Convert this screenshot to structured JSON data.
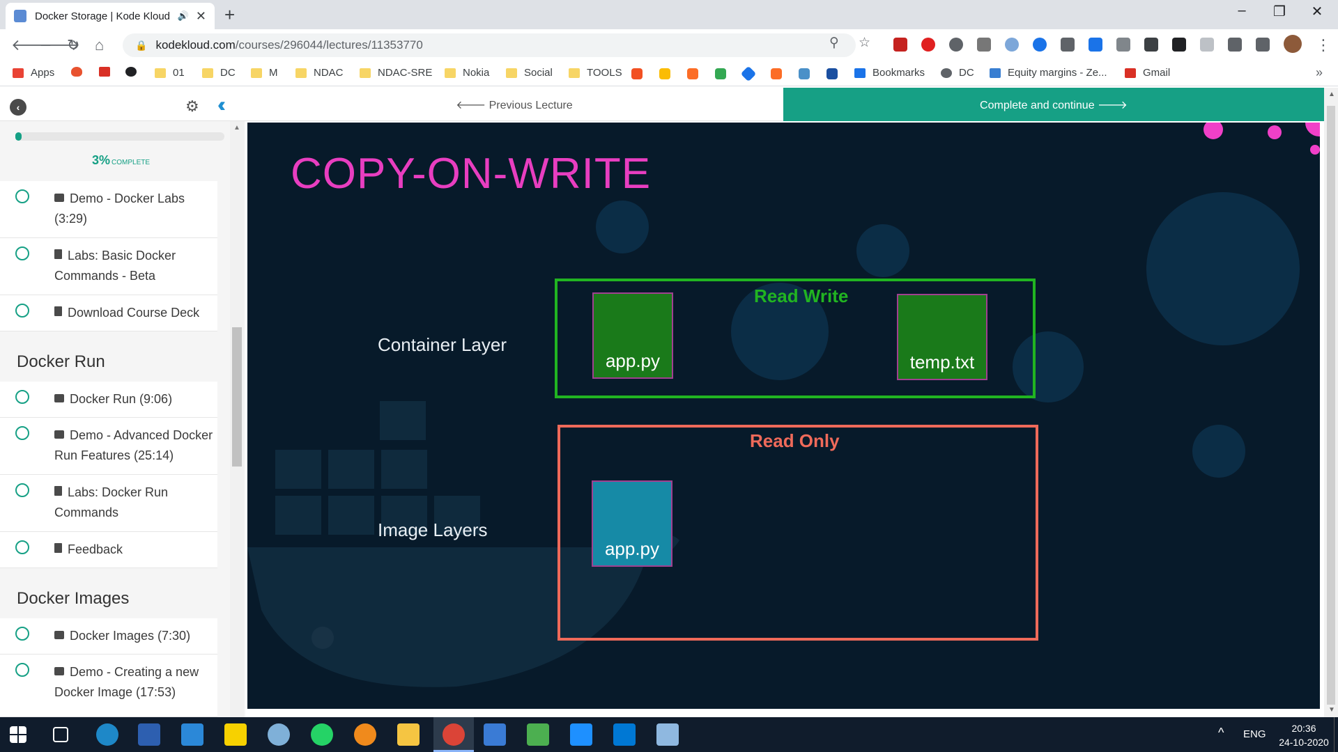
{
  "browser": {
    "tab_title": "Docker Storage | Kode Kloud",
    "new_tab_symbol": "+",
    "url_domain": "kodekloud.com",
    "url_path": "/courses/296044/lectures/11353770",
    "window_controls": [
      "–",
      "❐",
      "✕"
    ]
  },
  "bookmarks": [
    {
      "label": "Apps",
      "icon": "apps-grid-icon",
      "color": "#e94335"
    },
    {
      "label": "",
      "icon": "flame-icon",
      "color": "#e8522f"
    },
    {
      "label": "",
      "icon": "gmail-icon",
      "color": "#d93025"
    },
    {
      "label": "",
      "icon": "github-icon",
      "color": "#202124"
    },
    {
      "label": "01",
      "icon": "folder-icon",
      "color": "#f7d565"
    },
    {
      "label": "DC",
      "icon": "folder-icon",
      "color": "#f7d565"
    },
    {
      "label": "M",
      "icon": "folder-icon",
      "color": "#f7d565"
    },
    {
      "label": "NDAC",
      "icon": "folder-icon",
      "color": "#f7d565"
    },
    {
      "label": "NDAC-SRE",
      "icon": "folder-icon",
      "color": "#f7d565"
    },
    {
      "label": "Nokia",
      "icon": "folder-icon",
      "color": "#f7d565"
    },
    {
      "label": "Social",
      "icon": "folder-icon",
      "color": "#f7d565"
    },
    {
      "label": "TOOLS",
      "icon": "folder-icon",
      "color": "#f7d565"
    },
    {
      "label": "Bookmarks",
      "icon": "star-icon",
      "color": "#1a73e8"
    },
    {
      "label": "DC",
      "icon": "gear-globe-icon",
      "color": "#5f6368"
    },
    {
      "label": "Equity margins - Ze...",
      "icon": "zerodha-icon",
      "color": "#387ed1"
    },
    {
      "label": "Gmail",
      "icon": "gmail-icon",
      "color": "#d93025"
    }
  ],
  "sidebar": {
    "progress_percent": "3%",
    "progress_suffix": "COMPLETE",
    "progress_value": 0.03,
    "items_top": [
      {
        "label": "Demo - Docker Labs (3:29)",
        "kind": "video"
      },
      {
        "label": "Labs: Basic Docker Commands - Beta",
        "kind": "doc"
      },
      {
        "label": "Download Course Deck",
        "kind": "doc"
      }
    ],
    "section_docker_run": "Docker Run",
    "items_run": [
      {
        "label": "Docker Run (9:06)",
        "kind": "video"
      },
      {
        "label": "Demo - Advanced Docker Run Features (25:14)",
        "kind": "video"
      },
      {
        "label": "Labs: Docker Run Commands",
        "kind": "doc"
      },
      {
        "label": "Feedback",
        "kind": "doc"
      }
    ],
    "section_docker_images": "Docker Images",
    "items_images": [
      {
        "label": "Docker Images (7:30)",
        "kind": "video"
      },
      {
        "label": "Demo - Creating a new Docker Image (17:53)",
        "kind": "video"
      }
    ]
  },
  "lecture_nav": {
    "previous": "🡐 Previous Lecture",
    "next": "Complete and continue 🡒"
  },
  "slide": {
    "title": "COPY-ON-WRITE",
    "container_layer_label": "Container Layer",
    "image_layers_label": "Image Layers",
    "read_write_label": "Read Write",
    "read_only_label": "Read Only",
    "rw_file_1": "app.py",
    "rw_file_2": "temp.txt",
    "ro_file_1": "app.py",
    "colors": {
      "title": "#e83ec0",
      "read_write": "#21b421",
      "read_only": "#ef6a5a",
      "background": "#071a2a"
    }
  },
  "taskbar": {
    "language": "ENG",
    "time": "20:36",
    "date": "24-10-2020"
  }
}
